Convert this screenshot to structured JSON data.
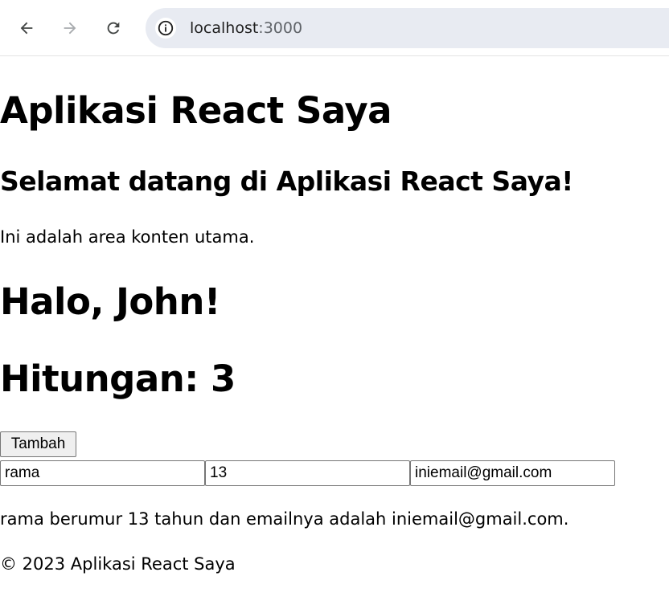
{
  "browser": {
    "url_host": "localhost",
    "url_port": ":3000",
    "icons": {
      "back": "back-arrow-icon",
      "forward": "forward-arrow-icon",
      "reload": "reload-icon",
      "site_info": "info-icon"
    }
  },
  "page": {
    "app_title": "Aplikasi React Saya",
    "welcome_heading": "Selamat datang di Aplikasi React Saya!",
    "intro_text": "Ini adalah area konten utama.",
    "greeting": "Halo, John!",
    "counter_text": "Hitungan: 3",
    "increment_button_label": "Tambah",
    "form": {
      "name_value": "rama",
      "age_value": "13",
      "email_value": "iniemail@gmail.com"
    },
    "summary_text": "rama berumur 13 tahun dan emailnya adalah iniemail@gmail.com.",
    "footer_text": "© 2023 Aplikasi React Saya"
  },
  "colors": {
    "toolbar_bg": "#ffffff",
    "address_bar_bg": "#e8ebf2",
    "icon_active": "#444746",
    "icon_disabled": "#a8abae",
    "button_bg": "#efefef",
    "control_border": "#767676"
  }
}
